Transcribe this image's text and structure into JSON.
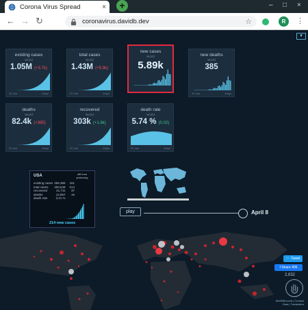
{
  "browser": {
    "tab_title": "Corona Virus Spread",
    "tab_close": "×",
    "new_tab": "+",
    "window_controls": [
      "–",
      "□",
      "×"
    ],
    "url": "coronavirus.davidb.dev",
    "back": "←",
    "forward": "→",
    "reload": "↻",
    "bookmark": "☆",
    "profile_initial": "R",
    "menu": "⋮"
  },
  "dashboard": {
    "expand": "▾",
    "cards": [
      {
        "label": "existing cases",
        "sub": "World",
        "value": "1.05M",
        "delta": "(+3.7k)",
        "delta_kind": "neg",
        "axis_start": "22 Jan",
        "axis_end": "8 Apr",
        "selected": false,
        "curve": "exp"
      },
      {
        "label": "total cases",
        "sub": "World",
        "value": "1.43M",
        "delta": "(+5.9k)",
        "delta_kind": "neg",
        "axis_start": "22 Jan",
        "axis_end": "8 Apr",
        "selected": false,
        "curve": "exp"
      },
      {
        "label": "new cases",
        "sub": "World",
        "value": "5.89k",
        "delta": "",
        "delta_kind": "",
        "axis_start": "",
        "axis_end": "",
        "selected": true,
        "curve": "bars"
      },
      {
        "label": "new deaths",
        "sub": "World",
        "value": "385",
        "delta": "",
        "delta_kind": "",
        "axis_start": "22 Jan",
        "axis_end": "8 Apr",
        "selected": false,
        "curve": "bars"
      },
      {
        "label": "deaths",
        "sub": "World",
        "value": "82.4k",
        "delta": "(+385)",
        "delta_kind": "neg",
        "axis_start": "22 Jan",
        "axis_end": "8 Apr",
        "selected": false,
        "curve": "exp"
      },
      {
        "label": "recovered",
        "sub": "World",
        "value": "303k",
        "delta": "(+1.8k)",
        "delta_kind": "pos",
        "axis_start": "22 Jan",
        "axis_end": "8 Apr",
        "selected": false,
        "curve": "exp"
      },
      {
        "label": "death rate",
        "sub": "World",
        "value": "5.74 %",
        "delta": "(0.02)",
        "delta_kind": "pos",
        "axis_start": "22 Jan",
        "axis_end": "8 Apr",
        "selected": false,
        "curve": "rate"
      }
    ]
  },
  "country_panel": {
    "name": "USA",
    "diff_header": "diff from yesterday",
    "rows": [
      {
        "label": "existing cases",
        "value": "366,365",
        "diff": "161"
      },
      {
        "label": "total cases",
        "value": "400,549",
        "diff": "214"
      },
      {
        "label": "recovered",
        "value": "21,711",
        "diff": "37"
      },
      {
        "label": "deaths",
        "value": "12,857",
        "diff": "16"
      },
      {
        "label": "death rate",
        "value": "3.21 %",
        "diff": ""
      }
    ],
    "caption": "214 new cases"
  },
  "timeline": {
    "play_label": "play",
    "date": "April 8"
  },
  "social": {
    "tweet": "🐦 Tweet",
    "share": "f Share 406",
    "visits": "2,632"
  },
  "footer": {
    "line1": "MrWBB/covid | Contact",
    "line2": "Data | Translation"
  },
  "colors": {
    "background": "#0c1b27",
    "card": "#1c2d3d",
    "accent_blue": "#4ad6ff",
    "negative": "#ff4d5a",
    "positive": "#38c98c",
    "selected_border": "#e5293f"
  }
}
